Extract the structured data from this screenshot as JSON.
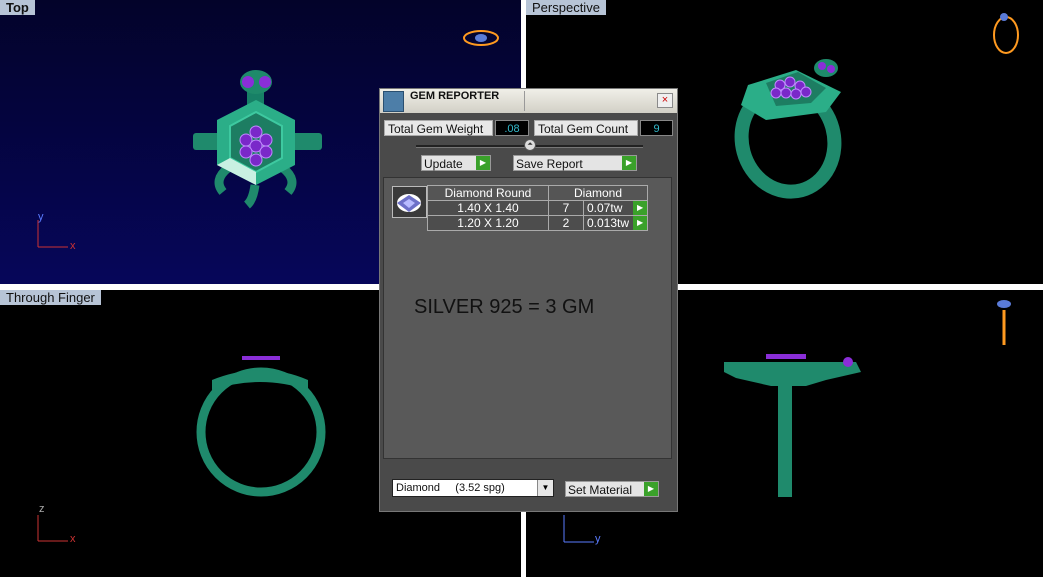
{
  "viewports": {
    "top": {
      "label": "Top",
      "axis_v": "y",
      "axis_h": "x"
    },
    "perspective": {
      "label": "Perspective"
    },
    "through_finger": {
      "label": "Through Finger",
      "axis_v": "z",
      "axis_h": "x"
    },
    "side": {
      "axis_v": "",
      "axis_h": "y"
    }
  },
  "dialog": {
    "title": "GEM REPORTER",
    "close_glyph": "×",
    "total_weight_label": "Total Gem Weight",
    "total_weight_value": ".08",
    "total_count_label": "Total Gem Count",
    "total_count_value": "9",
    "splitter_glyph": "⏶",
    "update_label": "Update",
    "save_report_label": "Save Report",
    "arrow_glyph": "▶",
    "table": {
      "headers": [
        "Diamond Round",
        "Diamond"
      ],
      "rows": [
        {
          "size": "1.40 X 1.40",
          "count": "7",
          "tw": "0.07tw"
        },
        {
          "size": "1.20 X 1.20",
          "count": "2",
          "tw": "0.013tw"
        }
      ]
    },
    "note": "SILVER 925 = 3 GM",
    "material_select": "Diamond     (3.52 spg)",
    "select_arrow": "▼",
    "set_material_label": "Set Material"
  },
  "colors": {
    "model_green": "#1f8a6c",
    "gem_purple": "#8a2ed8",
    "accent_arrow": "#3aa12a"
  },
  "icons": [
    "gem-reporter-icon",
    "close-icon",
    "gem-thumbnail-icon",
    "ring-nav-icon"
  ]
}
